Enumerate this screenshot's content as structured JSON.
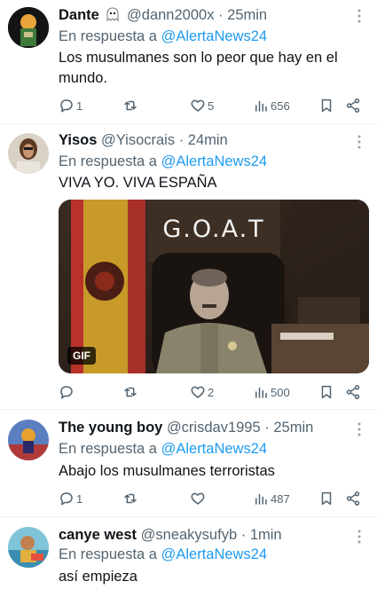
{
  "tweets": [
    {
      "name": "Dante",
      "name_icon": "ghost-emoji",
      "handle": "@dann2000x",
      "time": "25min",
      "reply_prefix": "En respuesta a",
      "reply_mention": "@AlertaNews24",
      "text": "Los musulmanes son lo peor que hay en el mundo.",
      "replies": "1",
      "retweets": "",
      "likes": "5",
      "views": "656"
    },
    {
      "name": "Yisos",
      "handle": "@Yisocrais",
      "time": "24min",
      "reply_prefix": "En respuesta a",
      "reply_mention": "@AlertaNews24",
      "text": "VIVA YO. VIVA ESPAÑA",
      "media": {
        "type": "gif",
        "overlay_text": "G.O.A.T",
        "badge": "GIF"
      },
      "replies": "",
      "retweets": "",
      "likes": "2",
      "views": "500"
    },
    {
      "name": "The young boy",
      "handle": "@crisdav1995",
      "time": "25min",
      "reply_prefix": "En respuesta a",
      "reply_mention": "@AlertaNews24",
      "text": "Abajo los musulmanes terroristas",
      "replies": "1",
      "retweets": "",
      "likes": "",
      "views": "487"
    },
    {
      "name": "canye west",
      "handle": "@sneakysufyb",
      "time": "1min",
      "reply_prefix": "En respuesta a",
      "reply_mention": "@AlertaNews24",
      "text": "así empieza"
    }
  ],
  "separator": "·",
  "colors": {
    "link": "#1d9bf0",
    "muted": "#536471",
    "text": "#0f1419",
    "divider": "#eff3f4"
  }
}
